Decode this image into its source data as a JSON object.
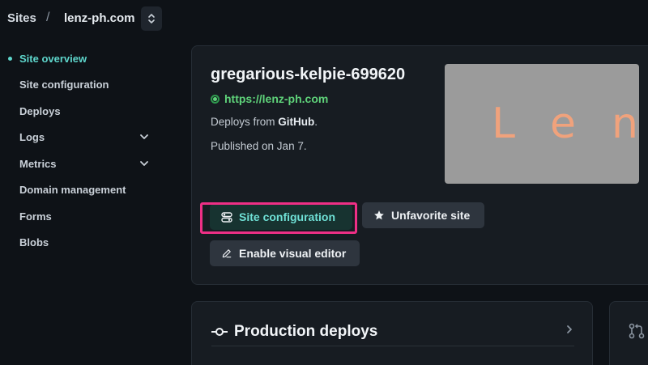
{
  "breadcrumb": {
    "root": "Sites",
    "separator": "/",
    "site": "lenz-ph.com"
  },
  "sidebar": {
    "items": [
      {
        "label": "Site overview",
        "active": true
      },
      {
        "label": "Site configuration"
      },
      {
        "label": "Deploys"
      },
      {
        "label": "Logs",
        "expandable": true
      },
      {
        "label": "Metrics",
        "expandable": true
      },
      {
        "label": "Domain management"
      },
      {
        "label": "Forms"
      },
      {
        "label": "Blobs"
      }
    ]
  },
  "overview": {
    "site_name": "gregarious-kelpie-699620",
    "url": "https://lenz-ph.com",
    "deploys_from_prefix": "Deploys from ",
    "deploys_from_source": "GitHub",
    "deploys_from_suffix": ".",
    "published": "Published on Jan 7.",
    "preview_text": "Len"
  },
  "buttons": {
    "site_configuration": "Site configuration",
    "unfavorite": "Unfavorite site",
    "visual_editor": "Enable visual editor"
  },
  "production": {
    "title": "Production deploys"
  },
  "colors": {
    "accent": "#5ed6cc",
    "status_green": "#5fd37a",
    "highlight": "#ef2f86",
    "background": "#0e1217",
    "card": "#171c22"
  }
}
